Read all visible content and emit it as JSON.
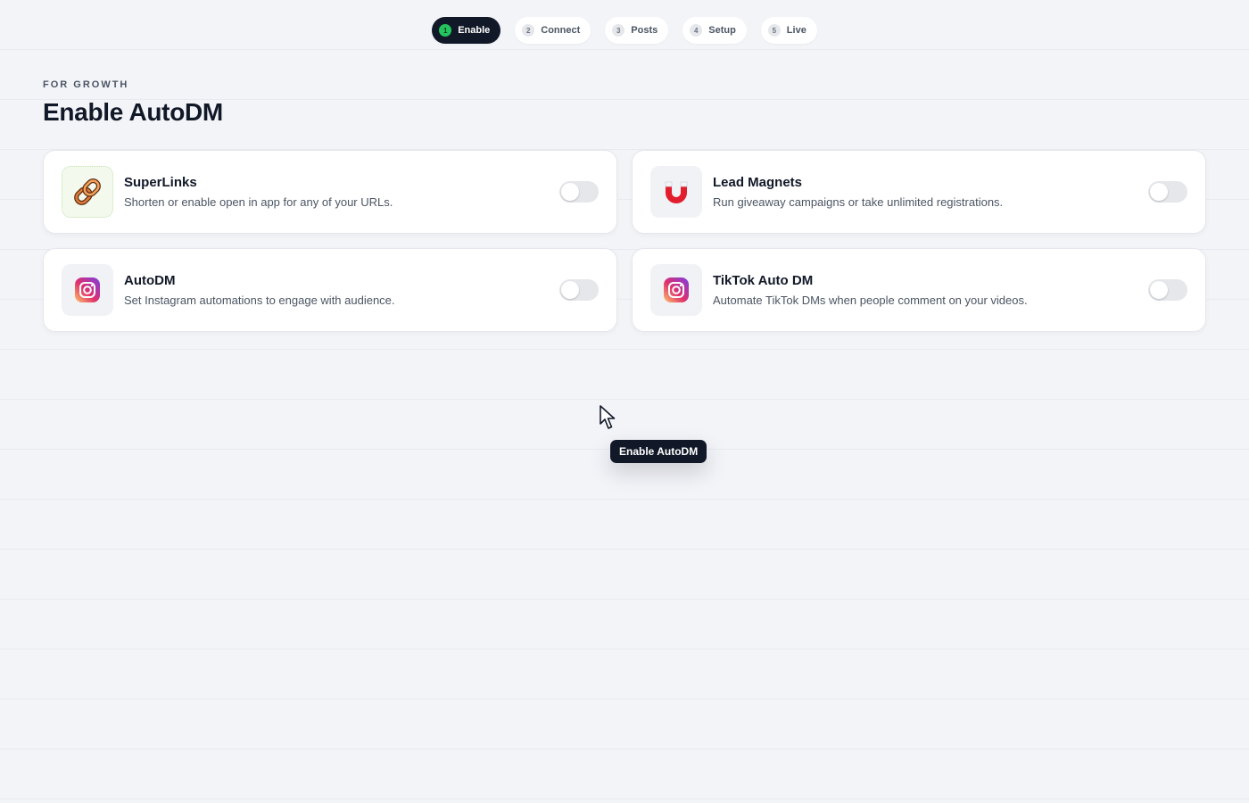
{
  "stepper": [
    {
      "num": "1",
      "label": "Enable",
      "active": true
    },
    {
      "num": "2",
      "label": "Connect",
      "active": false
    },
    {
      "num": "3",
      "label": "Posts",
      "active": false
    },
    {
      "num": "4",
      "label": "Setup",
      "active": false
    },
    {
      "num": "5",
      "label": "Live",
      "active": false
    }
  ],
  "header": {
    "eyebrow": "FOR GROWTH",
    "title": "Enable AutoDM"
  },
  "features": [
    {
      "title": "SuperLinks",
      "description": "Shorten or enable open in app for any of your URLs.",
      "icon": "chain-link-icon",
      "enabled": false
    },
    {
      "title": "Lead Magnets",
      "description": "Run giveaway campaigns or take unlimited registrations.",
      "icon": "magnet-icon",
      "enabled": false
    },
    {
      "title": "AutoDM",
      "description": "Set Instagram automations to engage with audience.",
      "icon": "instagram-icon",
      "enabled": false
    },
    {
      "title": "TikTok Auto DM",
      "description": "Automate TikTok DMs when people comment on your videos.",
      "icon": "instagram-icon",
      "enabled": false
    }
  ],
  "tooltip": {
    "label": "Enable AutoDM"
  },
  "colors": {
    "accent_active_step": "#111827",
    "step_dot_active": "#22c55e",
    "background": "#f3f4f8"
  }
}
